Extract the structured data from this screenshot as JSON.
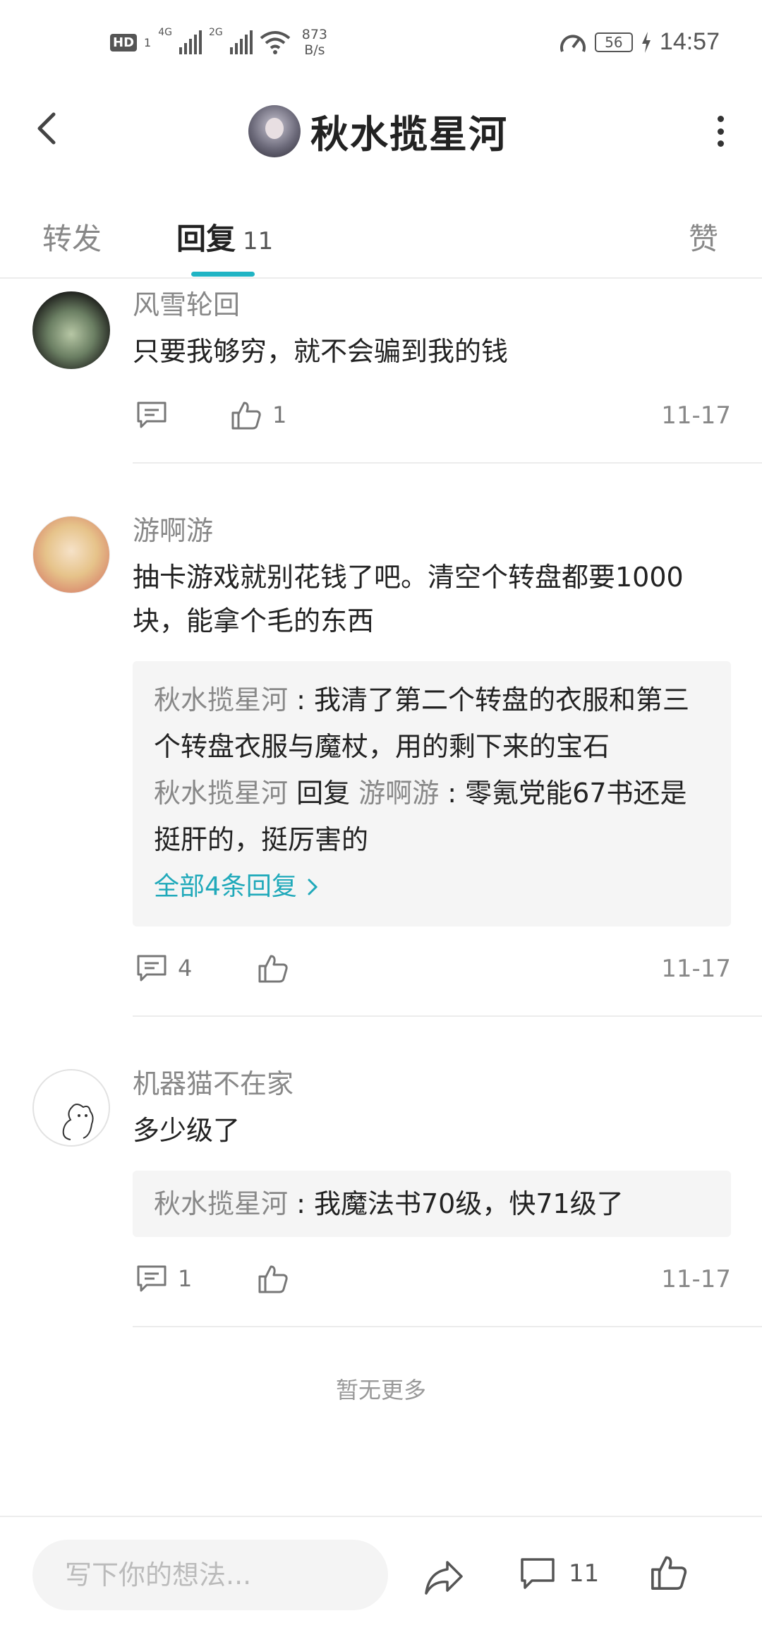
{
  "status_bar": {
    "hd": "HD",
    "sim1": "1",
    "net1": "4G",
    "net2": "2G",
    "speed_value": "873",
    "speed_unit": "B/s",
    "battery": "56",
    "time": "14:57"
  },
  "header": {
    "title": "秋水揽星河"
  },
  "tabs": {
    "forward": "转发",
    "reply": "回复",
    "reply_count": "11",
    "like": "赞"
  },
  "comments": [
    {
      "author": "风雪轮回",
      "content": "只要我够穷，就不会骗到我的钱",
      "reply_count": "",
      "like_count": "1",
      "date": "11-17"
    },
    {
      "author": "游啊游",
      "content": "抽卡游戏就别花钱了吧。清空个转盘都要1000块，能拿个毛的东西",
      "replies": [
        {
          "who": "秋水揽星河",
          "sep": " : ",
          "text": "我清了第二个转盘的衣服和第三个转盘衣服与魔杖，用的剩下来的宝石"
        },
        {
          "who": "秋水揽星河",
          "mid": " 回复 ",
          "to": "游啊游",
          "sep": " : ",
          "text": "零氪党能67书还是挺肝的，挺厉害的"
        }
      ],
      "all_replies": "全部4条回复",
      "reply_count": "4",
      "like_count": "",
      "date": "11-17"
    },
    {
      "author": "机器猫不在家",
      "content": "多少级了",
      "replies": [
        {
          "who": "秋水揽星河",
          "sep": " : ",
          "text": "我魔法书70级，快71级了"
        }
      ],
      "reply_count": "1",
      "like_count": "",
      "date": "11-17"
    }
  ],
  "no_more": "暂无更多",
  "bottom_bar": {
    "input_placeholder": "写下你的想法...",
    "comment_count": "11"
  },
  "colors": {
    "accent": "#20b4c4",
    "link": "#20a9ba",
    "muted": "#888888",
    "reply_bg": "#f5f5f5"
  }
}
